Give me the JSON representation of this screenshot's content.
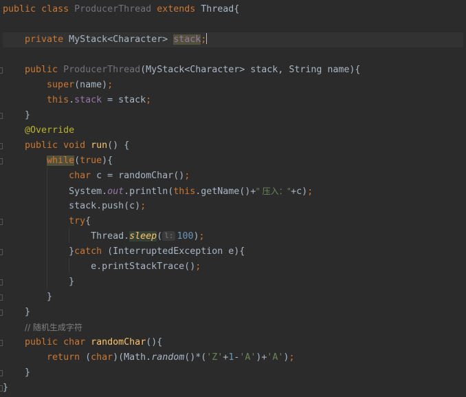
{
  "editor": {
    "language": "Java",
    "theme_bg": "#2b2b2b",
    "lines": {
      "l1": {
        "kw1": "public",
        "kw2": "class",
        "name": "ProducerThread",
        "kw3": "extends",
        "sup": "Thread",
        "brace": "{"
      },
      "l3": {
        "kw": "private",
        "type": "MyStack<Character>",
        "field": "stack",
        "semi": ";"
      },
      "l5": {
        "kw": "public",
        "name": "ProducerThread",
        "params": "(MyStack<Character> stack, String name){"
      },
      "l6": {
        "kw": "super",
        "rest": "(name)",
        "semi": ";"
      },
      "l7": {
        "kw": "this",
        "dot": ".",
        "field": "stack",
        "rest": " = stack",
        "semi": ";"
      },
      "l8": {
        "text": "}"
      },
      "l9": {
        "text": "@Override"
      },
      "l10": {
        "kw1": "public",
        "kw2": "void",
        "fn": "run",
        "rest": "() {"
      },
      "l11": {
        "kw": "while",
        "p1": "(",
        "kw2": "true",
        "p2": "){"
      },
      "l12": {
        "kw": "char",
        "rest": " c = randomChar()",
        "semi": ";"
      },
      "l13": {
        "pre": "System.",
        "field": "out",
        "mid": ".println(",
        "kw": "this",
        "mid2": ".getName()+",
        "str": "\" 压入：\"",
        "end": "+c)",
        "semi": ";"
      },
      "l14": {
        "pre": "stack.push(c)",
        "semi": ";"
      },
      "l15": {
        "kw": "try",
        "brace": "{"
      },
      "l16": {
        "pre": "Thread.",
        "fn": "sleep",
        "p": "(",
        "hint": "l:",
        "num": "100",
        "end": ")",
        "semi": ";"
      },
      "l17": {
        "pre": "}",
        "kw": "catch",
        "rest": " (InterruptedException e){"
      },
      "l18": {
        "pre": "e.printStackTrace()",
        "semi": ";"
      },
      "l19": {
        "text": "}"
      },
      "l20": {
        "text": "}"
      },
      "l21": {
        "text": "}"
      },
      "l22": {
        "text": "// 随机生成字符"
      },
      "l23": {
        "kw1": "public",
        "kw2": "char",
        "fn": "randomChar",
        "rest": "(){"
      },
      "l24": {
        "kw": "return",
        "p1": " (",
        "kw2": "char",
        "p2": ")(Math.",
        "fn": "random",
        "p3": "()*(",
        "s1": "'Z'",
        "op1": "+",
        "n1": "1",
        "op2": "-",
        "s2": "'A'",
        "op3": ")+",
        "s3": "'A'",
        "end": ")",
        "semi": ";"
      },
      "l25": {
        "text": "}"
      },
      "l26": {
        "text": "}"
      }
    }
  }
}
